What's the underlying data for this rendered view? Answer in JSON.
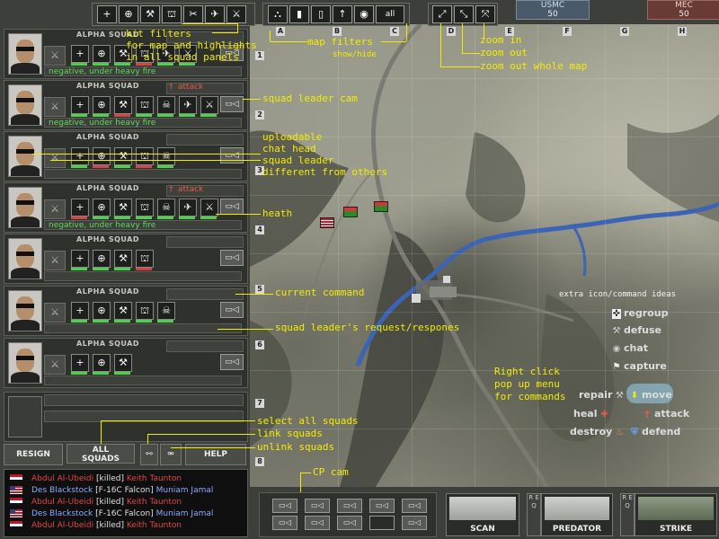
{
  "top": {
    "kit_filters": [
      "+",
      "⊕",
      "⚒",
      "⛫",
      "✂",
      "✈",
      "⚔"
    ],
    "map_filters": [
      "⛬",
      "▮",
      "▯",
      "↑",
      "◉",
      "all"
    ],
    "zoom": [
      "⤢",
      "⤡",
      "⤧"
    ],
    "letters": [
      "A",
      "B",
      "C",
      "D",
      "E",
      "F",
      "G",
      "H"
    ],
    "score_usmc": {
      "team": "USMC",
      "value": "50"
    },
    "score_mec": {
      "team": "MEC",
      "value": "50"
    }
  },
  "rows": [
    "1",
    "2",
    "3",
    "4",
    "5",
    "6",
    "7",
    "8"
  ],
  "squads": [
    {
      "name": "ALPHA SQUAD",
      "command": "",
      "status": "negative, under heavy fire",
      "kits": [
        "+",
        "⊕",
        "⚒",
        "⛫",
        "✈",
        "⚔"
      ]
    },
    {
      "name": "ALPHA SQUAD",
      "command": "attack",
      "status": "negative, under heavy fire",
      "kits": [
        "+",
        "⊕",
        "⚒",
        "⛫",
        "☠",
        "✈",
        "⚔"
      ]
    },
    {
      "name": "ALPHA SQUAD",
      "command": "",
      "status": "",
      "kits": [
        "+",
        "⊕",
        "⚒",
        "⛫",
        "☠"
      ]
    },
    {
      "name": "ALPHA SQUAD",
      "command": "attack",
      "status": "negative, under heavy fire",
      "kits": [
        "+",
        "⊕",
        "⚒",
        "⛫",
        "☠",
        "✈",
        "⚔"
      ]
    },
    {
      "name": "ALPHA SQUAD",
      "command": "",
      "status": "",
      "kits": [
        "+",
        "⊕",
        "⚒",
        "⛫"
      ]
    },
    {
      "name": "ALPHA SQUAD",
      "command": "",
      "status": "",
      "kits": [
        "+",
        "⊕",
        "⚒",
        "⛫",
        "☠"
      ]
    },
    {
      "name": "ALPHA SQUAD",
      "command": "",
      "status": "",
      "kits": [
        "+",
        "⊕",
        "⚒"
      ]
    }
  ],
  "buttons": {
    "resign": "RESIGN",
    "all_squads_1": "ALL",
    "all_squads_2": "SQUADS",
    "help": "HELP",
    "scan": "SCAN",
    "predator": "PREDATOR",
    "strike": "STRIKE",
    "req": "R E Q"
  },
  "killfeed": [
    {
      "flag": "iq",
      "killer": "Abdul Al-Ubeidi",
      "event": "[killed]",
      "victim": "Keith Taunton",
      "cls": "kf-red"
    },
    {
      "flag": "us",
      "killer": "Des Blackstock",
      "event": "[F-16C Falcon]",
      "victim": "Muniam Jamal",
      "cls": "kf-blue"
    },
    {
      "flag": "iq",
      "killer": "Abdul Al-Ubeidi",
      "event": "[killed]",
      "victim": "Keith Taunton",
      "cls": "kf-red"
    },
    {
      "flag": "us",
      "killer": "Des Blackstock",
      "event": "[F-16C Falcon]",
      "victim": "Muniam Jamal",
      "cls": "kf-blue"
    },
    {
      "flag": "iq",
      "killer": "Abdul Al-Ubeidi",
      "event": "[killed]",
      "victim": "Keith Taunton",
      "cls": "kf-red"
    }
  ],
  "annotations": {
    "kit_filters": "kit filters",
    "kit_filters_2": "for map and highlights",
    "kit_filters_3": "in all squad panels",
    "map_filters": "map filters",
    "show_hide": "show/hide",
    "zoom_in": "zoom in",
    "zoom_out": "zoom out",
    "zoom_whole": "zoom out whole map",
    "squad_leader_cam": "squad leader cam",
    "uploadable": "uploadable",
    "chat_head": "chat head",
    "squad_leader": "squad leader",
    "different": "different from others",
    "heath": "heath",
    "current_command": "current command",
    "request": "squad leader's request/respones",
    "select_all": "select all squads",
    "link": "link squads",
    "unlink": "unlink squads",
    "cp_cam": "CP cam",
    "extra": "extra icon/command ideas",
    "right_click_1": "Right click",
    "right_click_2": "pop up menu",
    "right_click_3": "for commands"
  },
  "commands": {
    "regroup": "regroup",
    "defuse": "defuse",
    "chat": "chat",
    "capture": "capture",
    "repair": "repair",
    "move": "move",
    "heal": "heal",
    "attack": "attack",
    "destroy": "destroy",
    "defend": "defend"
  },
  "colors": {
    "status_green": "#5fd85f",
    "attack_red": "#e35a4a",
    "annotation_yellow": "#f2ec00",
    "kf_red": "#e04545",
    "kf_blue": "#8fa8ff"
  }
}
